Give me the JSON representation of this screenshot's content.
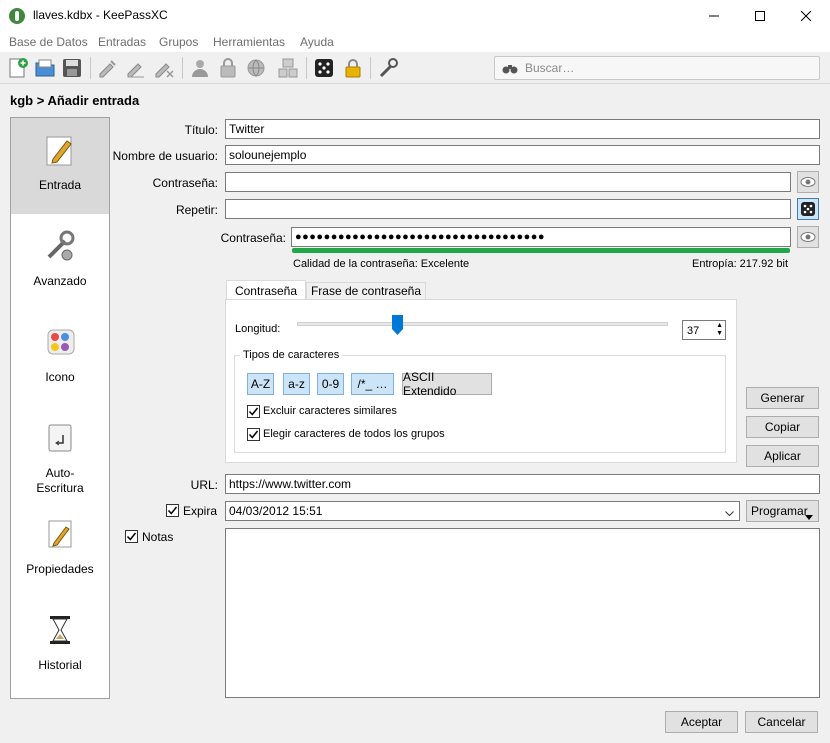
{
  "window": {
    "title": "llaves.kdbx - KeePassXC"
  },
  "menu": [
    "Base de Datos",
    "Entradas",
    "Grupos",
    "Herramientas",
    "Ayuda"
  ],
  "toolbar": {
    "search_placeholder": "Buscar…",
    "icons": [
      "new-database-icon",
      "open-database-icon",
      "save-database-icon",
      "add-entry-icon",
      "edit-entry-icon",
      "delete-entry-icon",
      "copy-username-icon",
      "copy-password-icon",
      "open-url-icon",
      "autotype-icon",
      "password-generator-icon",
      "lock-database-icon",
      "settings-icon"
    ]
  },
  "header": {
    "title": "kgb > Añadir entrada"
  },
  "sidenav": [
    {
      "label": "Entrada",
      "icon": "pencil-paper-icon",
      "active": true
    },
    {
      "label": "Avanzado",
      "icon": "wrench-gear-icon"
    },
    {
      "label": "Icono",
      "icon": "palette-icon"
    },
    {
      "label": "Auto-\nEscritura",
      "icon": "keyboard-key-icon"
    },
    {
      "label": "Propiedades",
      "icon": "document-edit-icon"
    },
    {
      "label": "Historial",
      "icon": "hourglass-icon"
    }
  ],
  "form": {
    "title_label": "Título:",
    "title_value": "Twitter",
    "username_label": "Nombre de usuario:",
    "username_value": "solounejemplo",
    "password_label": "Contraseña:",
    "password_value": "",
    "repeat_label": "Repetir:",
    "repeat_value": "",
    "generated_label": "Contraseña:",
    "generated_value": "●●●●●●●●●●●●●●●●●●●●●●●●●●●●●●●●●●●",
    "quality_text": "Calidad de la contraseña: Excelente",
    "entropy_text": "Entropía: 217.92 bit",
    "strength_color": "#1fa84a",
    "url_label": "URL:",
    "url_value": "https://www.twitter.com",
    "expires_label": "Expira",
    "expires_value": "04/03/2012 15:51",
    "schedule_label": "Programar",
    "notes_label": "Notas",
    "notes_value": ""
  },
  "generator": {
    "tabs": [
      "Contraseña",
      "Frase de contraseña"
    ],
    "length_label": "Longitud:",
    "length_value": "37",
    "slider_fraction": 0.27,
    "char_types_label": "Tipos de caracteres",
    "char_types": [
      "A-Z",
      "a-z",
      "0-9",
      "/*_ …"
    ],
    "extended_ascii_label": "ASCII Extendido",
    "exclude_similar_label": "Excluir caracteres similares",
    "all_groups_label": "Elegir caracteres de todos los grupos",
    "generate_label": "Generar",
    "copy_label": "Copiar",
    "apply_label": "Aplicar"
  },
  "footer": {
    "accept_label": "Aceptar",
    "cancel_label": "Cancelar"
  }
}
